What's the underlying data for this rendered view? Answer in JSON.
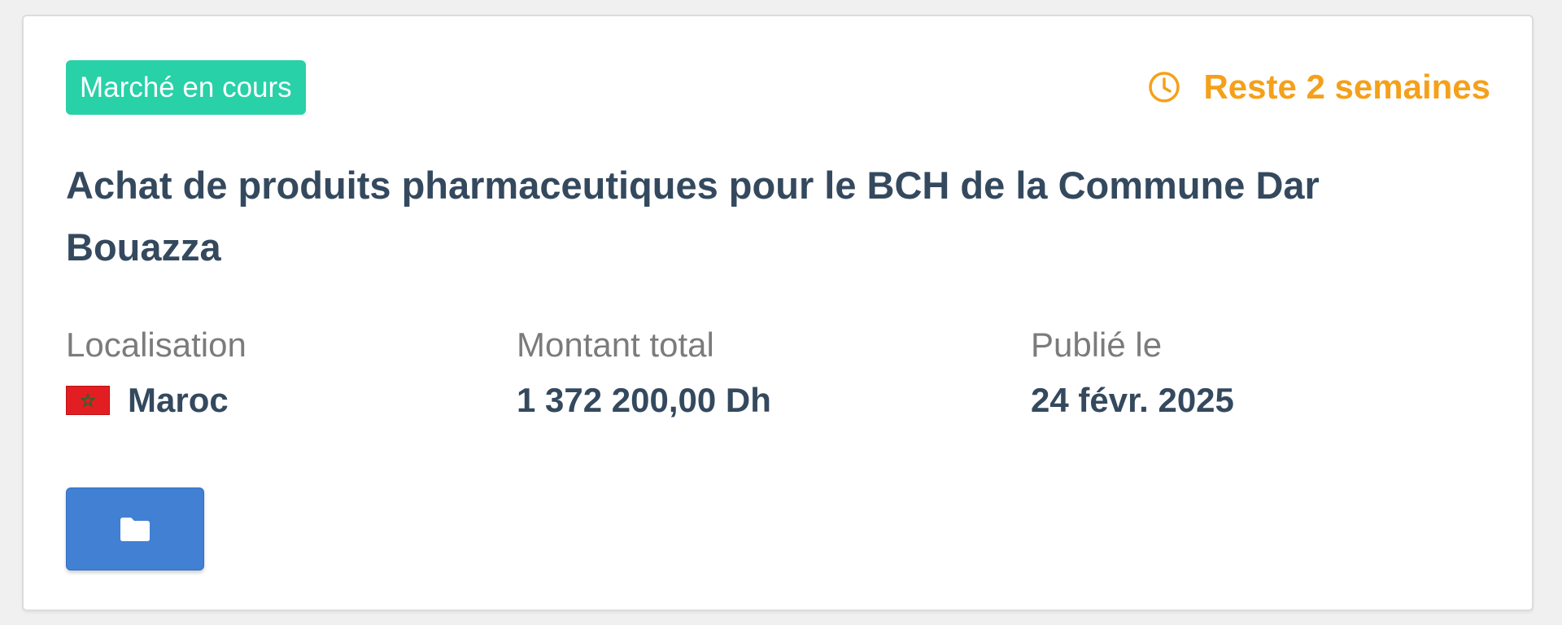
{
  "card": {
    "status_badge": "Marché en cours",
    "time_left": "Reste 2 semaines",
    "title": "Achat de produits pharmaceutiques pour le BCH de la Commune Dar Bouazza",
    "location": {
      "label": "Localisation",
      "value": "Maroc",
      "flag_icon": "morocco-flag-icon"
    },
    "amount": {
      "label": "Montant total",
      "value": "1 372 200,00 Dh"
    },
    "published": {
      "label": "Publié le",
      "value": "24 févr. 2025"
    },
    "folder_button_icon": "folder-icon"
  },
  "colors": {
    "badge_bg": "#28d1a8",
    "time_left": "#f5a01a",
    "title": "#34495e",
    "label": "#7b7b7b",
    "button": "#4180d3",
    "flag": "#e21e23"
  }
}
